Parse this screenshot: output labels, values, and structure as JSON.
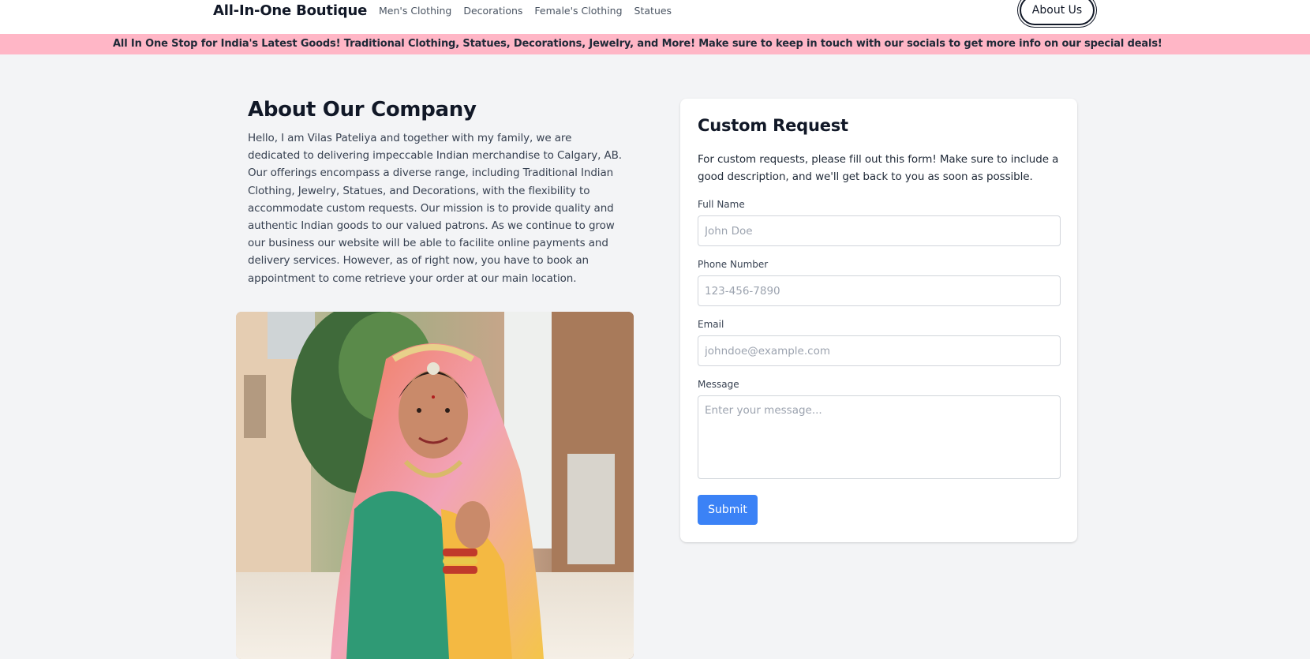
{
  "nav": {
    "brand": "All-In-One Boutique",
    "links": [
      "Men's Clothing",
      "Decorations",
      "Female's Clothing",
      "Statues"
    ],
    "about_label": "About Us"
  },
  "banner": {
    "text": "All In One Stop for India's Latest Goods! Traditional Clothing, Statues, Decorations, Jewelry, and More! Make sure to keep in touch with our socials to get more info on our special deals!",
    "color": "#ffb6c6"
  },
  "about": {
    "title": "About Our Company",
    "body": "Hello, I am Vilas Pateliya and together with my family, we are dedicated to delivering impeccable Indian merchandise to Calgary, AB. Our offerings encompass a diverse range, including Traditional Indian Clothing, Jewelry, Statues, and Decorations, with the flexibility to accommodate custom requests. Our mission is to provide quality and authentic Indian goods to our valued patrons. As we continue to grow our business our website will be able to facilite online payments and delivery services. However, as of right now, you have to book an appointment to come retrieve your order at our main location.",
    "image": "photo of a smiling woman in traditional Indian attire with jewelry"
  },
  "form": {
    "title": "Custom Request",
    "description": "For custom requests, please fill out this form! Make sure to include a good description, and we'll get back to you as soon as possible.",
    "fields": [
      {
        "label": "Full Name",
        "placeholder": "John Doe"
      },
      {
        "label": "Phone Number",
        "placeholder": "123-456-7890"
      },
      {
        "label": "Email",
        "placeholder": "johndoe@example.com"
      },
      {
        "label": "Message",
        "placeholder": "Enter your message..."
      }
    ],
    "submit_label": "Submit",
    "accent": "#3b82f6"
  }
}
